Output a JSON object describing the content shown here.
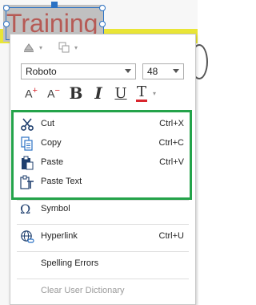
{
  "canvas": {
    "title_text": "Training",
    "accent": "#2b72c4",
    "highlight_color": "#24a34a"
  },
  "toolbar": {
    "font_family": "Roboto",
    "font_size": "48",
    "icons": [
      "shape-fill-icon",
      "paste-format-icon",
      "grow-font-icon",
      "shrink-font-icon",
      "bold-icon",
      "italic-icon",
      "underline-icon",
      "font-color-icon"
    ],
    "bold_glyph": "B",
    "italic_glyph": "I",
    "underline_glyph": "U",
    "grow_glyph": "A",
    "shrink_glyph": "A",
    "font_color_glyph": "T",
    "font_color": "#d9262e"
  },
  "menu": {
    "items": [
      {
        "label": "Cut",
        "shortcut": "Ctrl+X",
        "icon": "scissors-icon"
      },
      {
        "label": "Copy",
        "shortcut": "Ctrl+C",
        "icon": "copy-icon"
      },
      {
        "label": "Paste",
        "shortcut": "Ctrl+V",
        "icon": "paste-icon"
      },
      {
        "label": "Paste Text",
        "shortcut": "",
        "icon": "paste-text-icon"
      },
      {
        "label": "Symbol",
        "shortcut": "",
        "icon": "omega-icon"
      },
      {
        "label": "Hyperlink",
        "shortcut": "Ctrl+U",
        "icon": "globe-link-icon"
      },
      {
        "label": "Spelling Errors",
        "shortcut": "",
        "icon": ""
      },
      {
        "label": "Clear User Dictionary",
        "shortcut": "",
        "icon": "",
        "disabled": true
      }
    ]
  }
}
